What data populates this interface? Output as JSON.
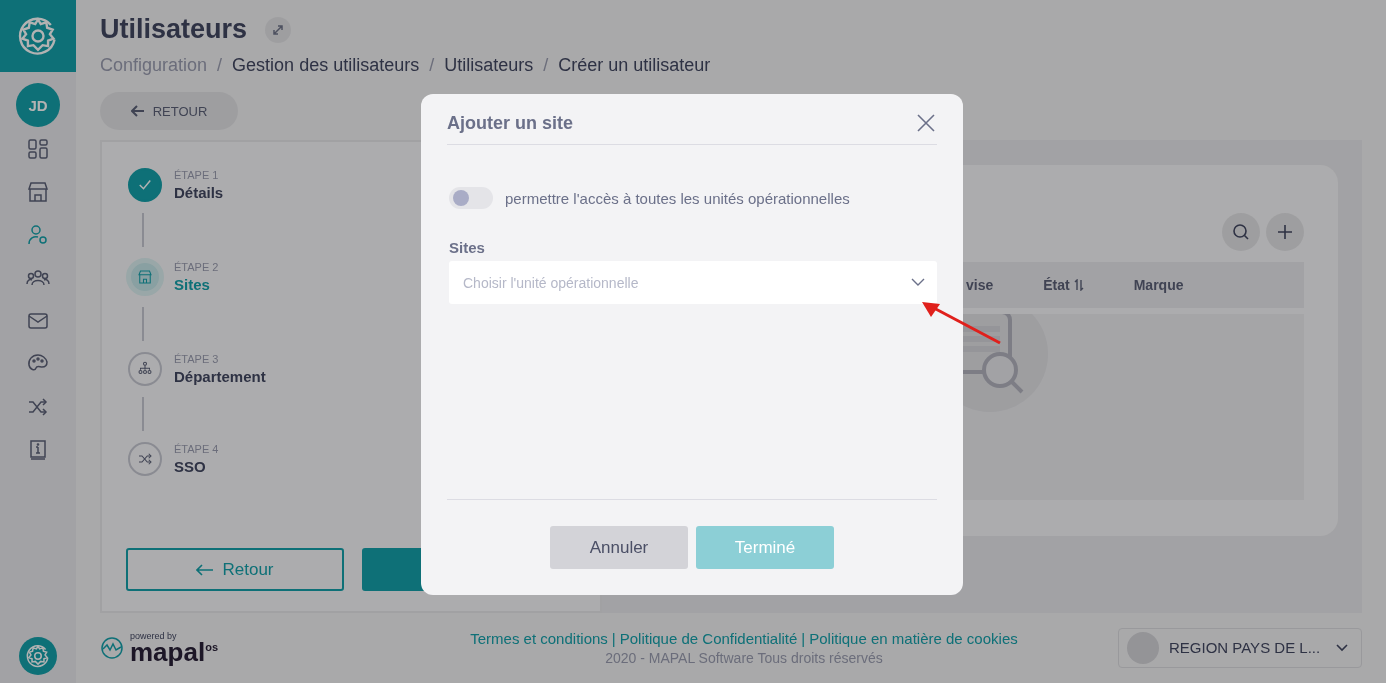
{
  "sidebar": {
    "items": [
      {
        "selected": false
      },
      {
        "selected": false
      },
      {
        "selected": true
      },
      {
        "selected": false
      },
      {
        "selected": false
      },
      {
        "selected": false
      },
      {
        "selected": false
      },
      {
        "selected": false
      }
    ],
    "avatar": "JD"
  },
  "header": {
    "title": "Utilisateurs",
    "breadcrumb": [
      "Configuration",
      "Gestion des utilisateurs",
      "Utilisateurs",
      "Créer un utilisateur"
    ],
    "breadcrumb_separator": "/",
    "back_button": "RETOUR"
  },
  "steps": [
    {
      "label": "ÉTAPE 1",
      "name": "Détails",
      "completed": true,
      "selected": false
    },
    {
      "label": "ÉTAPE 2",
      "name": "Sites",
      "completed": false,
      "selected": true
    },
    {
      "label": "ÉTAPE 3",
      "name": "Département",
      "completed": false,
      "selected": false
    },
    {
      "label": "ÉTAPE 4",
      "name": "SSO",
      "completed": false,
      "selected": false
    }
  ],
  "step_buttons": {
    "back": "Retour"
  },
  "table": {
    "columns": [
      "vise",
      "État",
      "Marque"
    ]
  },
  "modal": {
    "title": "Ajouter un site",
    "toggle": {
      "label": "permettre l'accès à toutes les unités opérationnelles",
      "on": false
    },
    "field_label": "Sites",
    "select": {
      "placeholder": "Choisir l'unité opérationnelle"
    },
    "buttons": [
      {
        "label": "Annuler",
        "disabled": false
      },
      {
        "label": "Terminé",
        "disabled": true
      }
    ]
  },
  "footer": {
    "powered_by": "powered by",
    "brand": "mapal",
    "brand_suffix": "os",
    "links": [
      "Termes et conditions",
      "Politique de Confidentialité",
      "Politique en matière de cookies"
    ],
    "separator": "|",
    "copyright": "2020 - MAPAL Software Tous droits réservés",
    "region": "REGION PAYS DE L..."
  }
}
